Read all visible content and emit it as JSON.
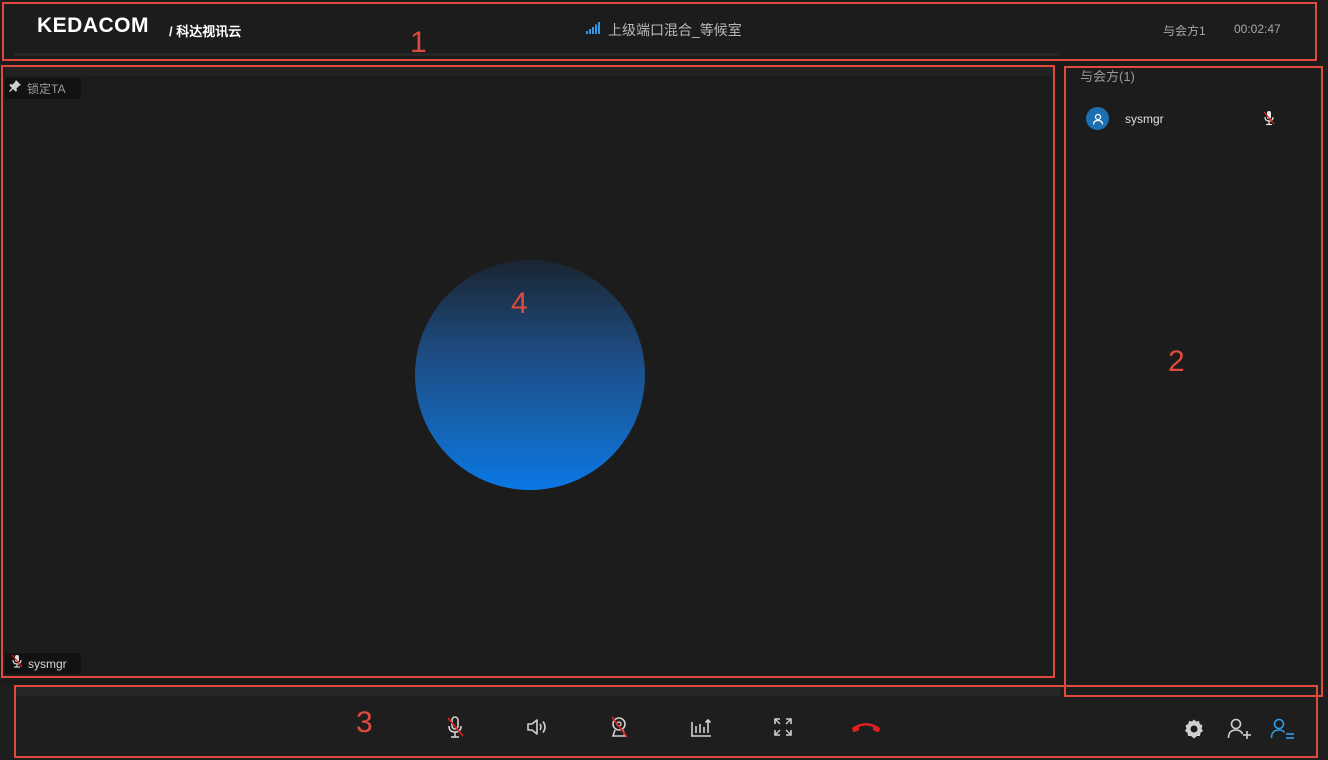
{
  "header": {
    "brand_logo": "KEDACOM",
    "brand_sub": "/ 科达视讯云",
    "meeting_title": "上级端口混合_等候室",
    "participant_count": "与会方1",
    "timer": "00:02:47"
  },
  "video": {
    "lock_label": "锁定TA",
    "participant_name": "sysmgr"
  },
  "panel": {
    "title": "与会方(1)",
    "participants": [
      {
        "name": "sysmgr",
        "muted": true
      }
    ]
  },
  "toolbar": {
    "buttons": [
      "mic-muted-icon",
      "speaker-icon",
      "camera-off-icon",
      "share-stats-icon",
      "fullscreen-icon",
      "hangup-icon",
      "settings-icon",
      "add-participant-icon",
      "participant-list-icon"
    ]
  },
  "annotations": {
    "labels": [
      "1",
      "2",
      "3",
      "4"
    ],
    "color": "#e04a3c"
  },
  "colors": {
    "accent": "#2f9be8",
    "hangup": "#e02020",
    "avatar": "#1d6fb0"
  }
}
